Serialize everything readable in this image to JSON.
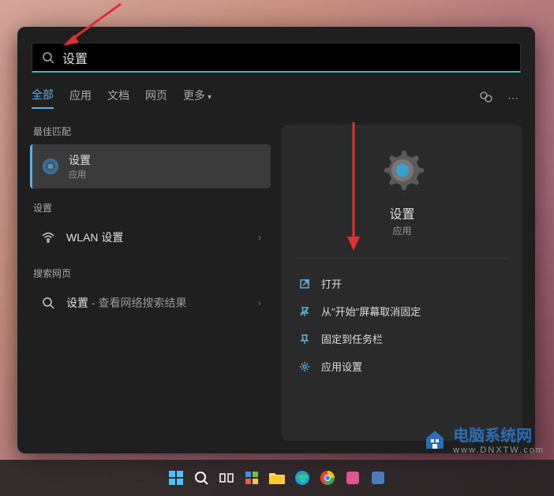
{
  "search": {
    "value": "设置",
    "placeholder": ""
  },
  "tabs": {
    "items": [
      {
        "label": "全部",
        "active": true
      },
      {
        "label": "应用",
        "active": false
      },
      {
        "label": "文档",
        "active": false
      },
      {
        "label": "网页",
        "active": false
      },
      {
        "label": "更多",
        "active": false,
        "hasCaret": true
      }
    ]
  },
  "sections": {
    "bestMatch": "最佳匹配",
    "settings": "设置",
    "web": "搜索网页"
  },
  "results": {
    "best": {
      "title": "设置",
      "subtitle": "应用"
    },
    "settings": {
      "title": "WLAN 设置"
    },
    "web": {
      "prefix": "设置",
      "suffix": " - 查看网络搜索结果"
    }
  },
  "preview": {
    "title": "设置",
    "subtitle": "应用",
    "actions": [
      {
        "icon": "open",
        "label": "打开"
      },
      {
        "icon": "unpin",
        "label": "从\"开始\"屏幕取消固定"
      },
      {
        "icon": "pin",
        "label": "固定到任务栏"
      },
      {
        "icon": "appsettings",
        "label": "应用设置"
      }
    ]
  },
  "watermark": {
    "text": "电脑系统网",
    "url": "www.DNXTW.com"
  }
}
